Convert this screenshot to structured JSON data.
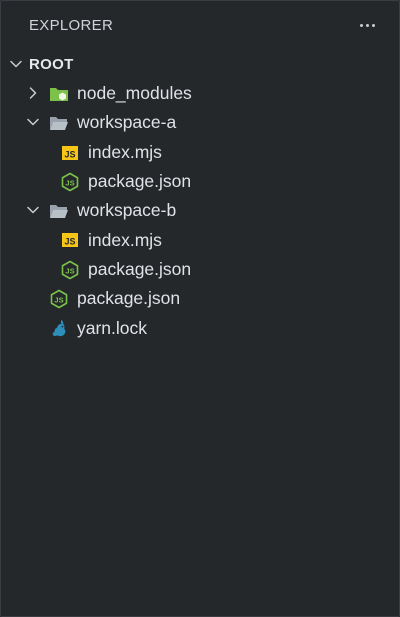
{
  "header": {
    "title": "EXPLORER",
    "more_icon": "ellipsis-icon"
  },
  "root": {
    "label": "ROOT",
    "expanded": true
  },
  "tree": {
    "node_modules": {
      "label": "node_modules",
      "icon": "node-modules-folder-icon",
      "expanded": false
    },
    "workspace_a": {
      "label": "workspace-a",
      "icon": "folder-open-icon",
      "expanded": true,
      "children": [
        {
          "label": "index.mjs",
          "icon": "js-file-icon"
        },
        {
          "label": "package.json",
          "icon": "nodejs-file-icon"
        }
      ]
    },
    "workspace_b": {
      "label": "workspace-b",
      "icon": "folder-open-icon",
      "expanded": true,
      "children": [
        {
          "label": "index.mjs",
          "icon": "js-file-icon"
        },
        {
          "label": "package.json",
          "icon": "nodejs-file-icon"
        }
      ]
    },
    "root_files": [
      {
        "label": "package.json",
        "icon": "nodejs-file-icon"
      },
      {
        "label": "yarn.lock",
        "icon": "yarn-file-icon"
      }
    ]
  },
  "colors": {
    "background": "#25282b",
    "js_badge": "#f5c518",
    "node_green": "#7cc24a",
    "yarn_blue": "#2c8ebb"
  }
}
